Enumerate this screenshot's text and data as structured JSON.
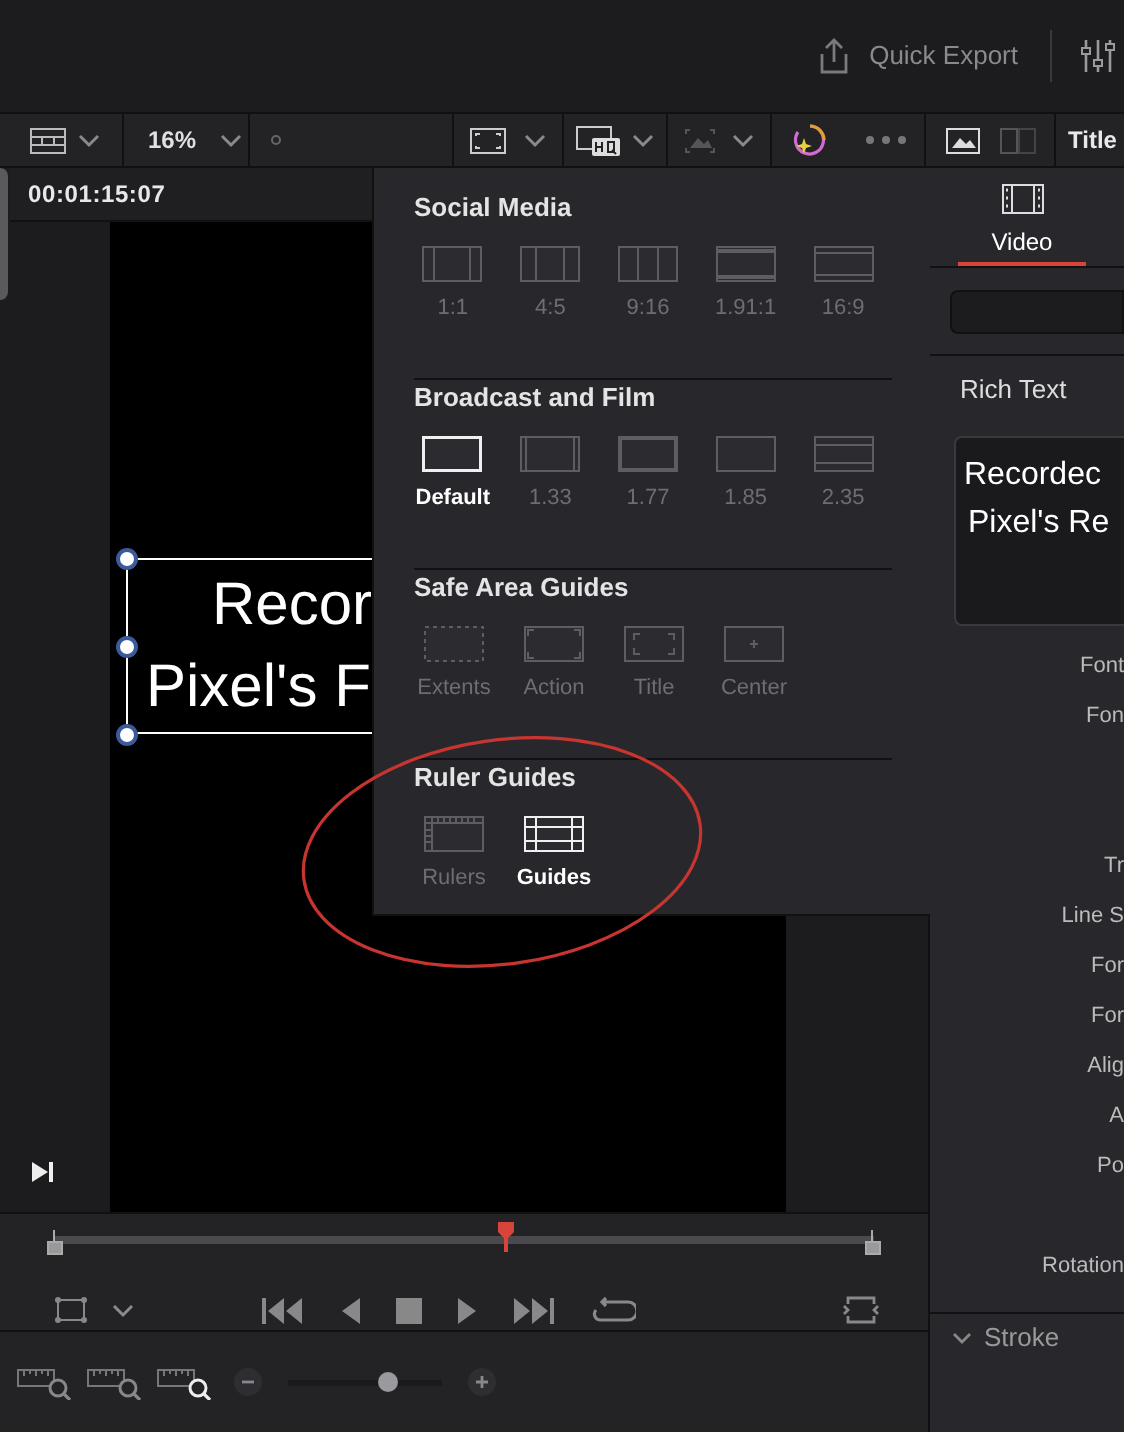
{
  "header": {
    "quick_export": "Quick Export"
  },
  "toolbar": {
    "zoom": "16%",
    "inspector_title": "Title"
  },
  "viewer": {
    "timecode": "00:01:15:07",
    "title_lines": [
      "Recor",
      "Pixel's F"
    ]
  },
  "overlay_menu": {
    "sections": [
      {
        "title": "Social Media",
        "options": [
          {
            "label": "1:1",
            "selected": false
          },
          {
            "label": "4:5",
            "selected": false
          },
          {
            "label": "9:16",
            "selected": false
          },
          {
            "label": "1.91:1",
            "selected": false
          },
          {
            "label": "16:9",
            "selected": false
          }
        ]
      },
      {
        "title": "Broadcast and Film",
        "options": [
          {
            "label": "Default",
            "selected": true
          },
          {
            "label": "1.33",
            "selected": false
          },
          {
            "label": "1.77",
            "selected": false
          },
          {
            "label": "1.85",
            "selected": false
          },
          {
            "label": "2.35",
            "selected": false
          }
        ]
      },
      {
        "title": "Safe Area Guides",
        "options": [
          {
            "label": "Extents",
            "selected": false
          },
          {
            "label": "Action",
            "selected": false
          },
          {
            "label": "Title",
            "selected": false
          },
          {
            "label": "Center",
            "selected": false
          }
        ]
      },
      {
        "title": "Ruler Guides",
        "options": [
          {
            "label": "Rulers",
            "selected": false
          },
          {
            "label": "Guides",
            "selected": true
          }
        ]
      }
    ]
  },
  "scrubber": {
    "level": 0.55
  },
  "zoom_slider": {
    "level": 0.65
  },
  "inspector": {
    "tabs": [
      {
        "label": "Video",
        "selected": true
      }
    ],
    "section_title": "Rich Text",
    "text_lines": [
      "Recordec",
      "Pixel's Re"
    ],
    "property_groups": [
      [
        "Font",
        "Fon"
      ],
      [
        "Tr",
        "Line S",
        "For",
        "For",
        "Alig",
        "A",
        "Po"
      ],
      [
        "Rotation"
      ]
    ],
    "collapsed_section": "Stroke"
  }
}
